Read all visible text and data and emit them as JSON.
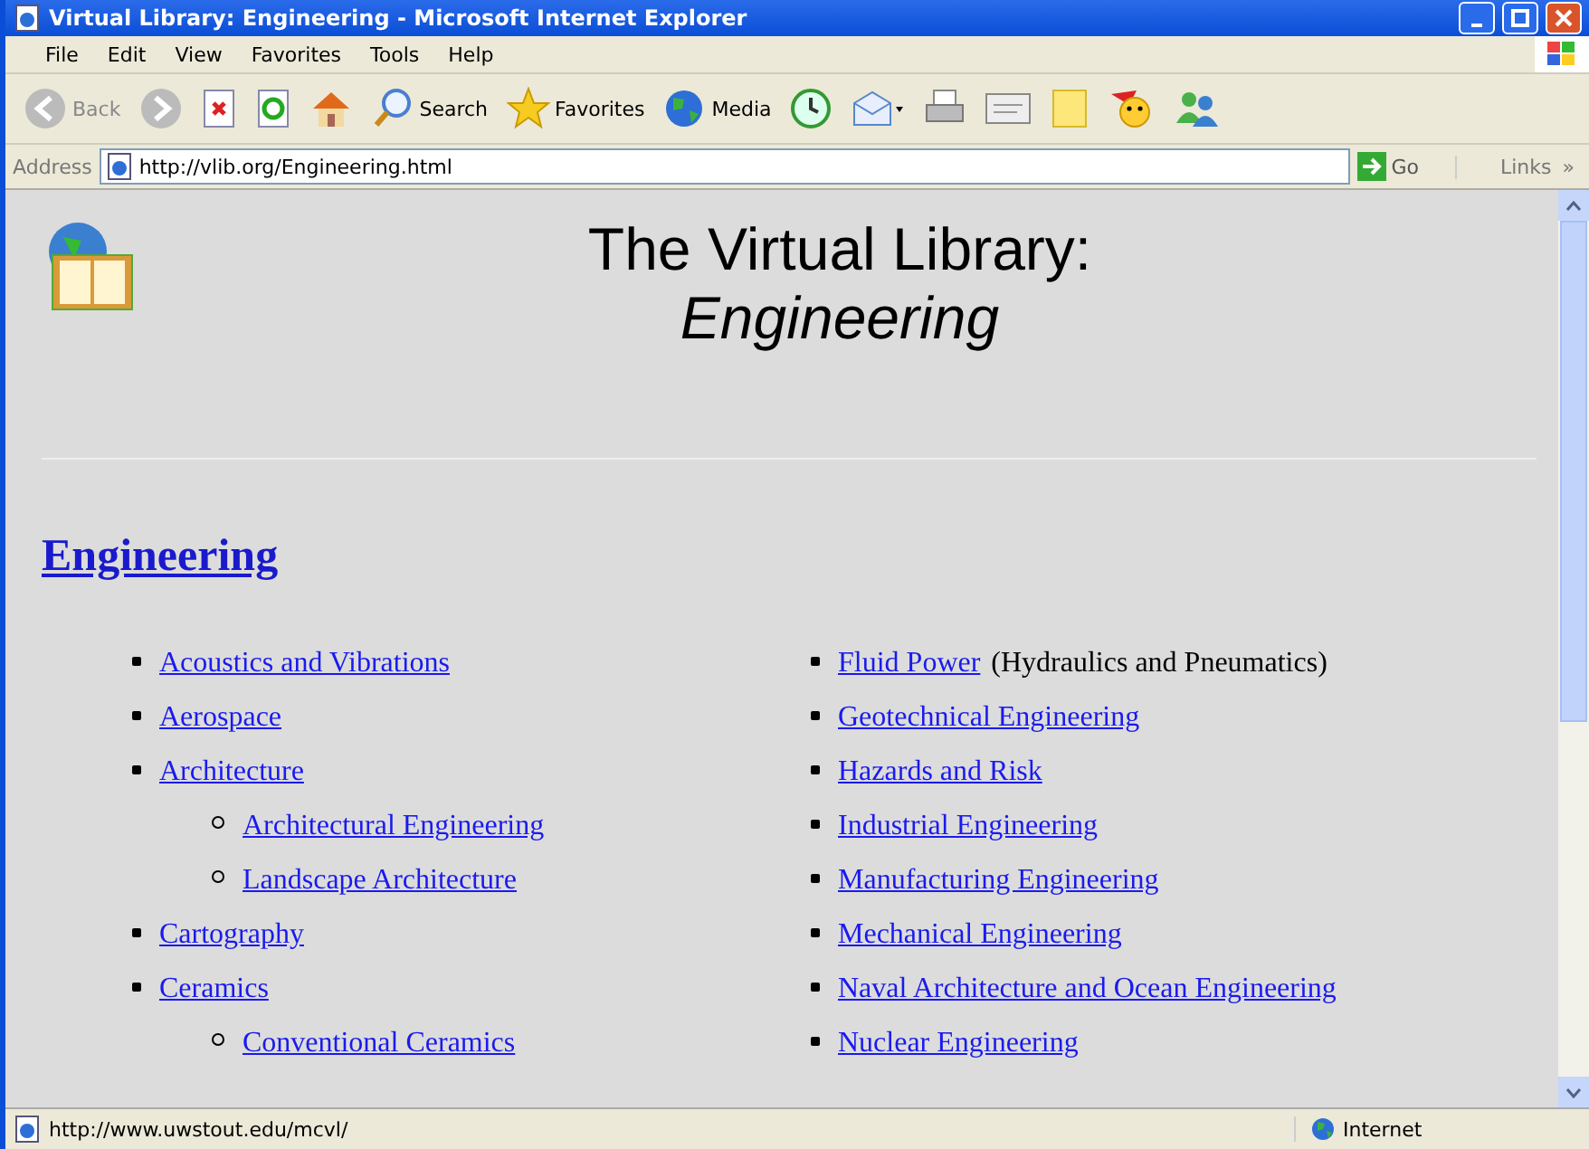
{
  "window": {
    "title": "Virtual Library: Engineering - Microsoft Internet Explorer"
  },
  "menu": [
    "File",
    "Edit",
    "View",
    "Favorites",
    "Tools",
    "Help"
  ],
  "toolbar": [
    {
      "kind": "back",
      "label": "Back"
    },
    {
      "kind": "forward"
    },
    {
      "kind": "stop"
    },
    {
      "kind": "refresh"
    },
    {
      "kind": "home"
    },
    {
      "kind": "search",
      "label": "Search"
    },
    {
      "kind": "favorites",
      "label": "Favorites"
    },
    {
      "kind": "media",
      "label": "Media"
    },
    {
      "kind": "history"
    },
    {
      "kind": "mail"
    },
    {
      "kind": "print"
    },
    {
      "kind": "edit"
    },
    {
      "kind": "note"
    },
    {
      "kind": "messenger"
    },
    {
      "kind": "people"
    }
  ],
  "address": {
    "label": "Address",
    "value": "http://vlib.org/Engineering.html",
    "go": "Go",
    "links": "Links",
    "more": "»"
  },
  "page": {
    "title": "The Virtual Library:",
    "subtitle": "Engineering",
    "heading": "Engineering",
    "columns": [
      {
        "items": [
          {
            "label": "Acoustics and Vibrations"
          },
          {
            "label": "Aerospace"
          },
          {
            "label": "Architecture",
            "children": [
              {
                "label": "Architectural Engineering"
              },
              {
                "label": "Landscape Architecture"
              }
            ]
          },
          {
            "label": "Cartography"
          },
          {
            "label": "Ceramics",
            "children": [
              {
                "label": "Conventional Ceramics"
              }
            ]
          }
        ]
      },
      {
        "items": [
          {
            "label": "Fluid Power",
            "note": "(Hydraulics and Pneumatics)"
          },
          {
            "label": "Geotechnical Engineering"
          },
          {
            "label": "Hazards and Risk"
          },
          {
            "label": "Industrial Engineering"
          },
          {
            "label": "Manufacturing Engineering"
          },
          {
            "label": "Mechanical Engineering"
          },
          {
            "label": "Naval Architecture and Ocean Engineering"
          },
          {
            "label": "Nuclear Engineering"
          }
        ]
      }
    ]
  },
  "status_bar": {
    "text": "http://www.uwstout.edu/mcvl/",
    "zone": "Internet"
  }
}
